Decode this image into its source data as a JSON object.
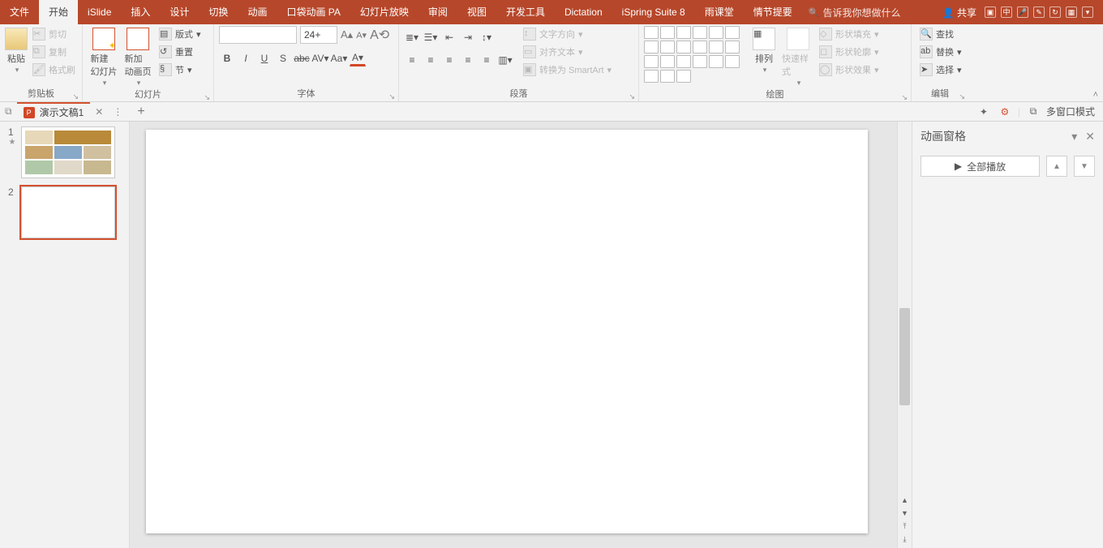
{
  "tabs": {
    "file": "文件",
    "start": "开始",
    "islide": "iSlide",
    "insert": "插入",
    "design": "设计",
    "transition": "切换",
    "animation": "动画",
    "pocket": "口袋动画 PA",
    "slideshow": "幻灯片放映",
    "review": "审阅",
    "view": "视图",
    "dev": "开发工具",
    "dictation": "Dictation",
    "ispring": "iSpring Suite 8",
    "rain": "雨课堂",
    "plot": "情节提要",
    "tellme": "告诉我你想做什么"
  },
  "share": "共享",
  "clipboard": {
    "paste": "粘贴",
    "cut": "剪切",
    "copy": "复制",
    "format_painter": "格式刷",
    "label": "剪贴板"
  },
  "slides": {
    "newslide": "新建\n幻灯片",
    "newanim": "新加\n动画页",
    "layout": "版式 ",
    "reset": "重置",
    "section": "节 ",
    "label": "幻灯片"
  },
  "font": {
    "size": "24+",
    "B": "B",
    "I": "I",
    "U": "U",
    "S": "S",
    "abc": "abc",
    "av": "AV",
    "aa": "Aa ",
    "a": "A ",
    "label": "字体"
  },
  "para": {
    "text_dir": "文字方向 ",
    "align_text": "对齐文本 ",
    "smartart": "转换为 SmartArt ",
    "label": "段落"
  },
  "drawing": {
    "arrange": "排列",
    "quick_style": "快速样式",
    "fill": "形状填充 ",
    "outline": "形状轮廓 ",
    "effects": "形状效果 ",
    "label": "绘图"
  },
  "editing": {
    "find": "查找",
    "replace": "替换 ",
    "select": "选择 ",
    "label": "编辑"
  },
  "doc": {
    "title": "演示文稿1",
    "multi": "多窗口模式"
  },
  "anim_pane": {
    "title": "动画窗格",
    "play_all": "全部播放"
  },
  "thumbs": [
    {
      "n": "1",
      "star": "★"
    },
    {
      "n": "2",
      "star": ""
    }
  ]
}
